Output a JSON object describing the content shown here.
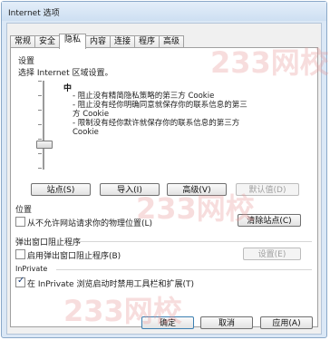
{
  "window": {
    "title": "Internet 选项"
  },
  "tabs": [
    {
      "label": "常规"
    },
    {
      "label": "安全"
    },
    {
      "label": "隐私"
    },
    {
      "label": "内容"
    },
    {
      "label": "连接"
    },
    {
      "label": "程序"
    },
    {
      "label": "高级"
    }
  ],
  "settings": {
    "heading": "设置",
    "zone_prompt": "选择 Internet 区域设置。",
    "level": "中",
    "description": [
      "- 阻止没有精简隐私策略的第三方 Cookie",
      "- 阻止没有经你明确同意就保存你的联系信息的第三",
      "方 Cookie",
      "- 限制没有经你默许就保存你的联系信息的第三方",
      "Cookie"
    ],
    "buttons": {
      "sites": "站点(S)",
      "import": "导入(I)",
      "advanced": "高级(V)",
      "default": "默认值(D)"
    }
  },
  "location": {
    "heading": "位置",
    "checkbox_label": "从不允许网站请求你的物理位置(L)",
    "clear_sites": "清除站点(C)"
  },
  "popup": {
    "heading": "弹出窗口阻止程序",
    "checkbox_label": "启用弹出窗口阻止程序(B)",
    "settings": "设置(E)"
  },
  "inprivate": {
    "heading": "InPrivate",
    "checkbox_label": "在 InPrivate 浏览启动时禁用工具栏和扩展(T)"
  },
  "footer": {
    "ok": "确定",
    "cancel": "取消",
    "apply": "应用(A)"
  },
  "watermark": {
    "text": "233网校"
  }
}
